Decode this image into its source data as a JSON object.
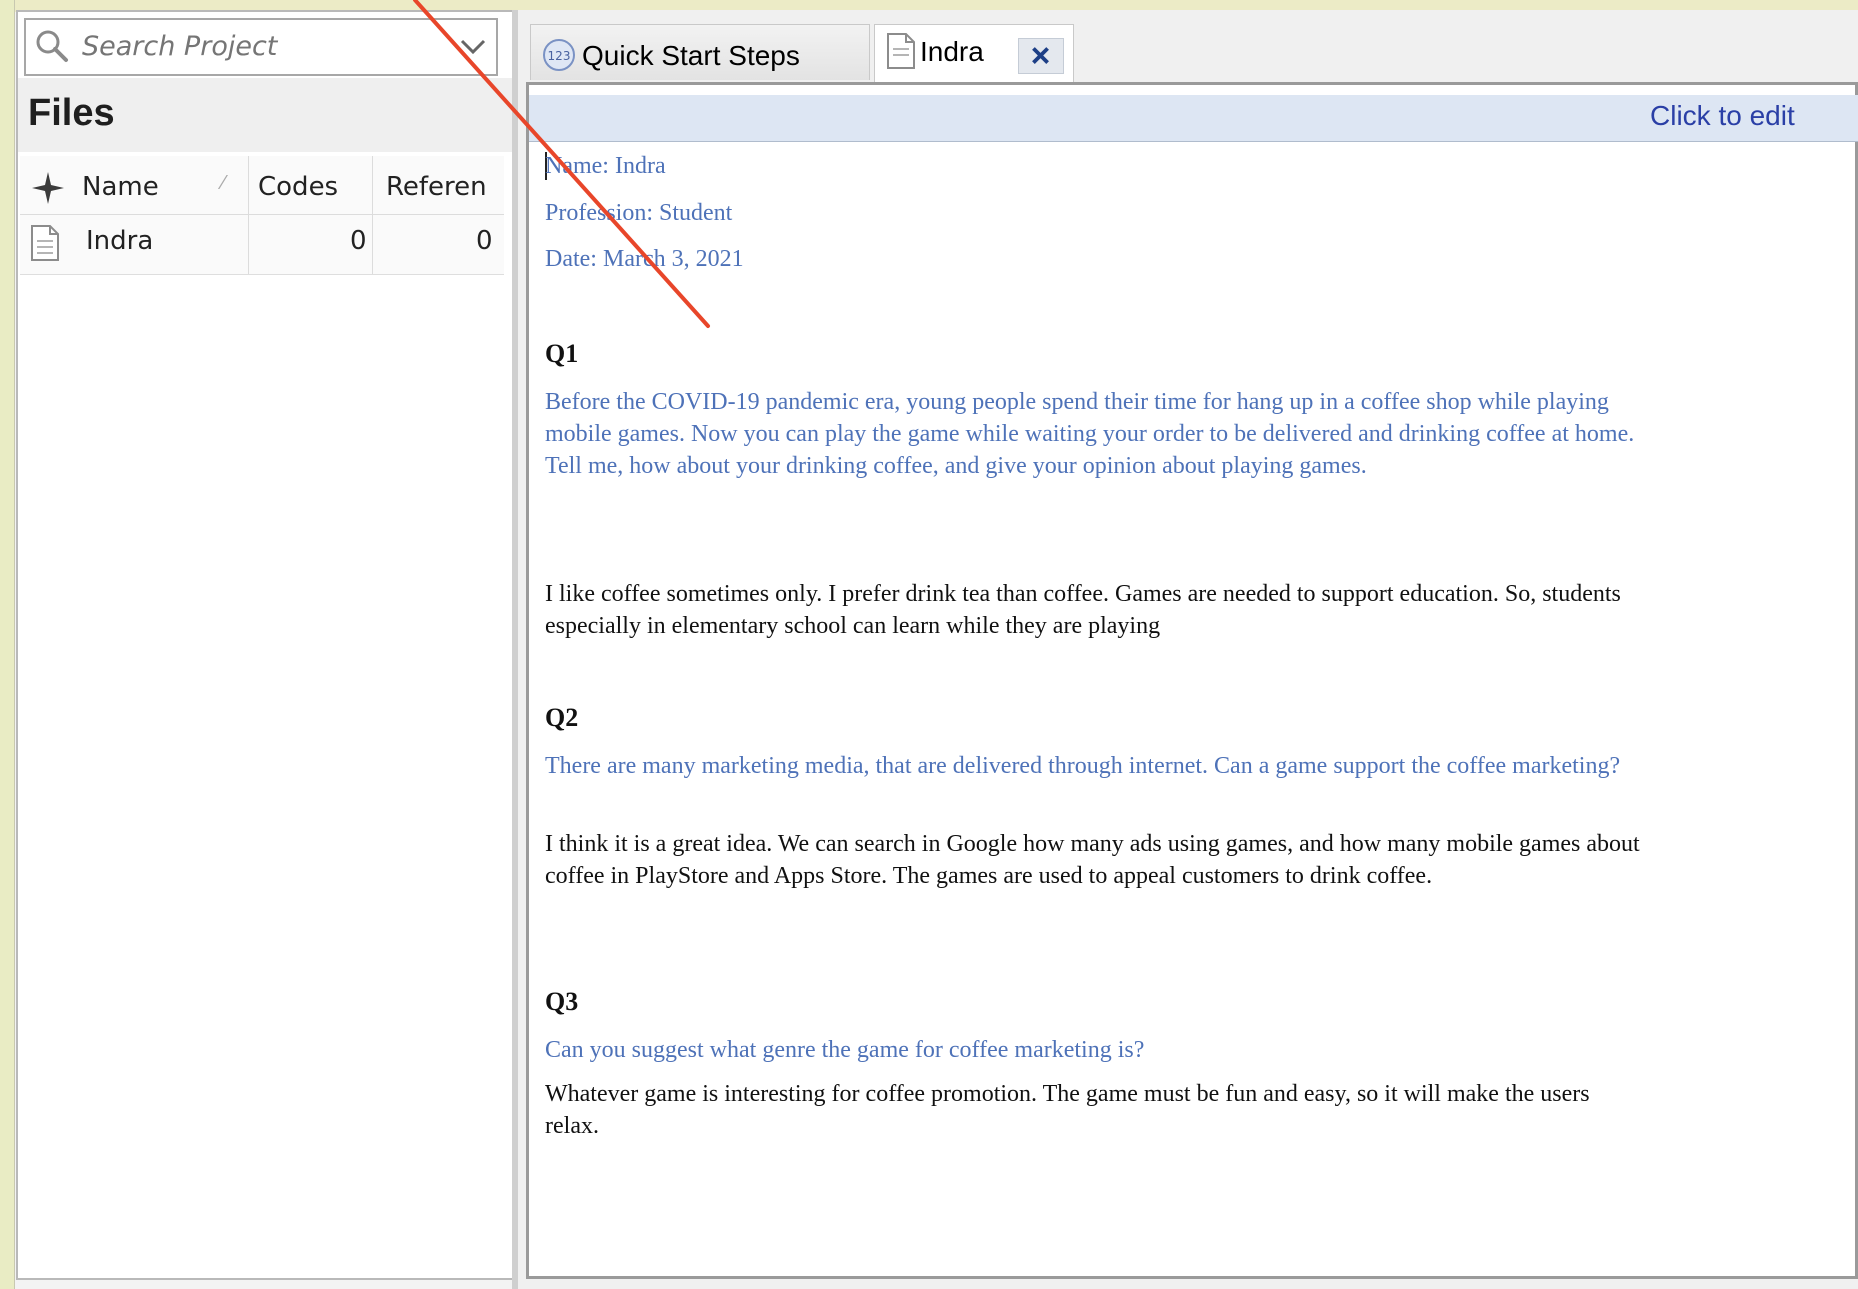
{
  "search": {
    "placeholder": "Search Project"
  },
  "files_panel": {
    "title": "Files",
    "columns": [
      "Name",
      "Codes",
      "Referen"
    ],
    "rows": [
      {
        "name": "Indra",
        "codes": "0",
        "references": "0"
      }
    ]
  },
  "tabs": [
    {
      "label": "Quick Start Steps",
      "icon": "numbered-list-icon"
    },
    {
      "label": "Indra",
      "icon": "document-icon",
      "closable": true
    }
  ],
  "edit_bar": {
    "label": "Click to edit"
  },
  "document": {
    "name_line": "Name: Indra",
    "profession_line": "Profession: Student",
    "date_line": "Date: March 3, 2021",
    "q1": {
      "heading": "Q1",
      "question": "Before the COVID-19 pandemic era, young people spend their time for hang up in a coffee shop while playing mobile games. Now you can play the game while waiting your order to be delivered and drinking coffee at home. Tell me, how about your drinking coffee, and give your opinion about playing games.",
      "answer": "I like coffee sometimes only.  I prefer drink tea than coffee. Games are needed to support education. So, students especially in elementary school can learn while they are playing"
    },
    "q2": {
      "heading": "Q2",
      "question": "There are many marketing media, that are delivered through internet. Can a game support the coffee marketing?",
      "answer": "I think it is a great idea. We can search in Google how many ads using games, and how many mobile games about coffee in PlayStore and Apps Store. The games are used to appeal customers to drink coffee."
    },
    "q3": {
      "heading": "Q3",
      "question": "Can you suggest what genre the game for coffee marketing is?",
      "answer": "Whatever game is interesting for coffee promotion. The game must be fun and easy, so it will make the users relax."
    }
  },
  "colors": {
    "question_text": "#4e72b8",
    "answer_text": "#111111",
    "edit_bar_bg": "#dde6f3",
    "edit_link": "#2a3fa6",
    "annotation_arrow": "#e8462a"
  }
}
